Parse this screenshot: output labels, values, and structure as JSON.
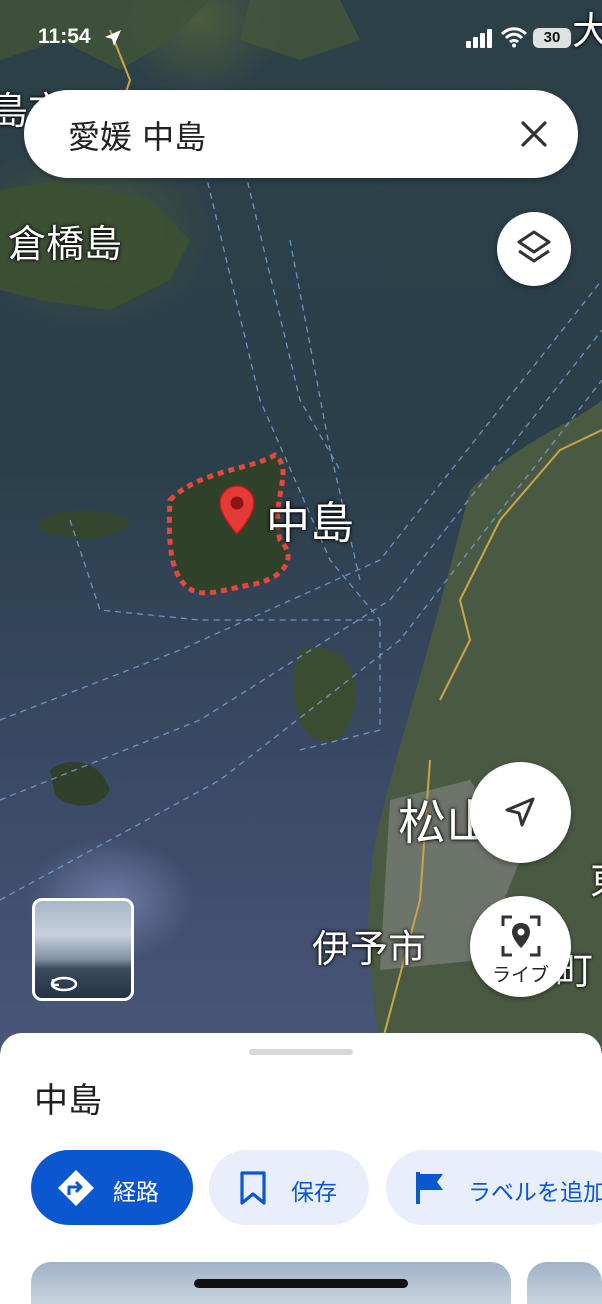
{
  "status_bar": {
    "time": "11:54",
    "battery": "30"
  },
  "search": {
    "query": "愛媛 中島"
  },
  "map_labels": {
    "kurahashi": "倉橋島",
    "nakajima": "中島",
    "matsuyama": "松山",
    "iyo": "伊予市",
    "top_right_partial": "大",
    "top_left_partial": "島市",
    "right_partial": "東",
    "bottom_right_partial": "町"
  },
  "map_controls": {
    "live_label": "ライブ"
  },
  "place_sheet": {
    "title": "中島",
    "actions": [
      {
        "label": "経路",
        "icon": "directions-icon"
      },
      {
        "label": "保存",
        "icon": "bookmark-icon"
      },
      {
        "label": "ラベルを追加",
        "icon": "flag-icon"
      }
    ]
  },
  "colors": {
    "accent": "#0b57d0",
    "pin": "#e53935"
  }
}
